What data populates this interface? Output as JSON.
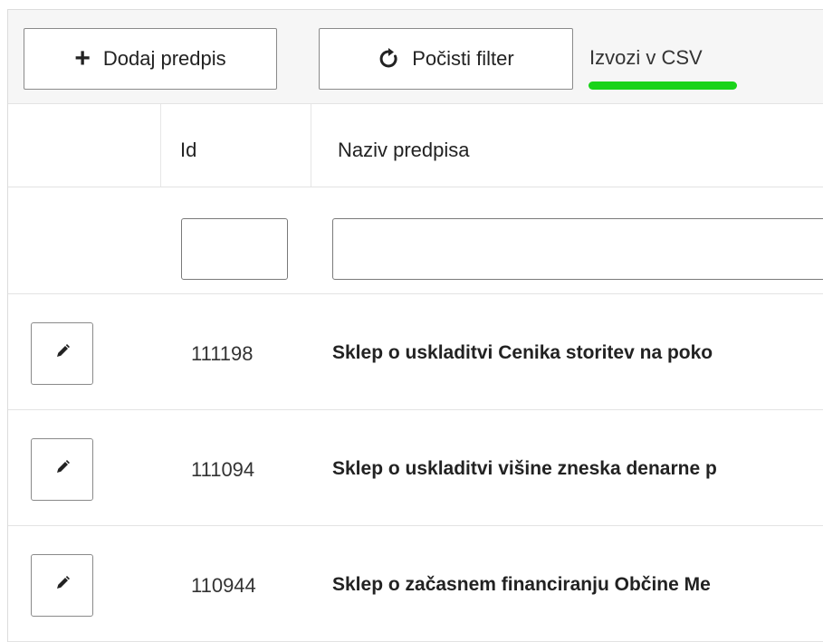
{
  "toolbar": {
    "add_label": "Dodaj predpis",
    "add_icon": "plus-icon",
    "clear_label": "Počisti filter",
    "clear_icon": "refresh-icon",
    "export_label": "Izvozi v CSV",
    "highlight_color": "#19d319"
  },
  "table": {
    "columns": [
      {
        "label": ""
      },
      {
        "label": "Id"
      },
      {
        "label": "Naziv predpisa"
      }
    ],
    "filters": {
      "id_value": "",
      "name_value": ""
    },
    "rows": [
      {
        "id": "111198",
        "name": "Sklep o uskladitvi Cenika storitev na poko"
      },
      {
        "id": "111094",
        "name": "Sklep o uskladitvi višine zneska denarne p"
      },
      {
        "id": "110944",
        "name": "Sklep o začasnem financiranju Občine Me"
      }
    ],
    "row_action_icon": "pencil-icon"
  }
}
